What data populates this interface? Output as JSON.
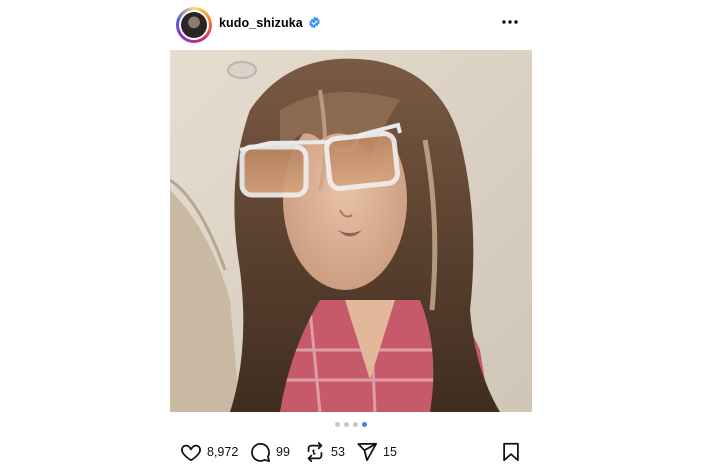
{
  "post": {
    "username": "kudo_shizuka",
    "verified": true,
    "more_icon": "more-horizontal-icon",
    "carousel": {
      "total": 4,
      "active_index": 3
    },
    "stats": {
      "likes": "8,972",
      "comments": "99",
      "reposts": "53",
      "shares": "15"
    },
    "icons": {
      "like": "heart-icon",
      "comment": "comment-bubble-icon",
      "repost": "repost-icon",
      "share": "send-icon",
      "save": "bookmark-icon"
    },
    "colors": {
      "verified": "#3897f0",
      "active_dot": "#3b82f6",
      "inactive_dot": "#c7c7c7"
    }
  }
}
